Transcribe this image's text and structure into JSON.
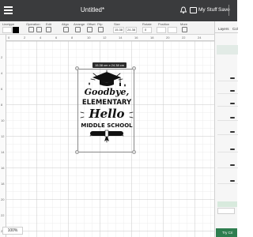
{
  "app": {
    "title": "Untitled*",
    "my_stuff_label": "My Stuff",
    "save_label": "Save"
  },
  "toolbar": {
    "linetype_label": "Linetype",
    "linetype_value": "Cut",
    "operation_label": "Operation",
    "select_all_label": "Select All",
    "edit_label": "Edit",
    "align_label": "Align",
    "arrange_label": "Arrange",
    "flip_label": "Flip",
    "offset_label": "Offset",
    "size_label": "Size",
    "width_value": "15.38",
    "height_value": "24.38",
    "rotate_label": "Rotate",
    "rotate_value": "0",
    "more_label": "More",
    "position_label": "Position"
  },
  "ruler": {
    "top": [
      "0",
      "2",
      "4",
      "6",
      "8",
      "10",
      "12",
      "14",
      "16",
      "18",
      "20",
      "22",
      "24"
    ],
    "left": [
      "2",
      "4",
      "6",
      "8",
      "10",
      "12",
      "14",
      "16",
      "18",
      "20",
      "22",
      "24"
    ]
  },
  "canvas": {
    "size_tip": "15.38 cm x 24.38 cm",
    "zoom": "100%"
  },
  "artwork": {
    "line1": "Goodbye,",
    "line2": "ELEMENTARY",
    "line3": "Hello",
    "line4": "MIDDLE SCHOOL"
  },
  "panel": {
    "tab_layers": "Layers",
    "tab_color": "Col",
    "selected_group": "Group",
    "blank_canvas": "Blank",
    "try_label": "Try Cri"
  },
  "colors": {
    "topbar": "#3a3b3d",
    "accent_green": "#2e7d4f",
    "art_black": "#111111"
  }
}
